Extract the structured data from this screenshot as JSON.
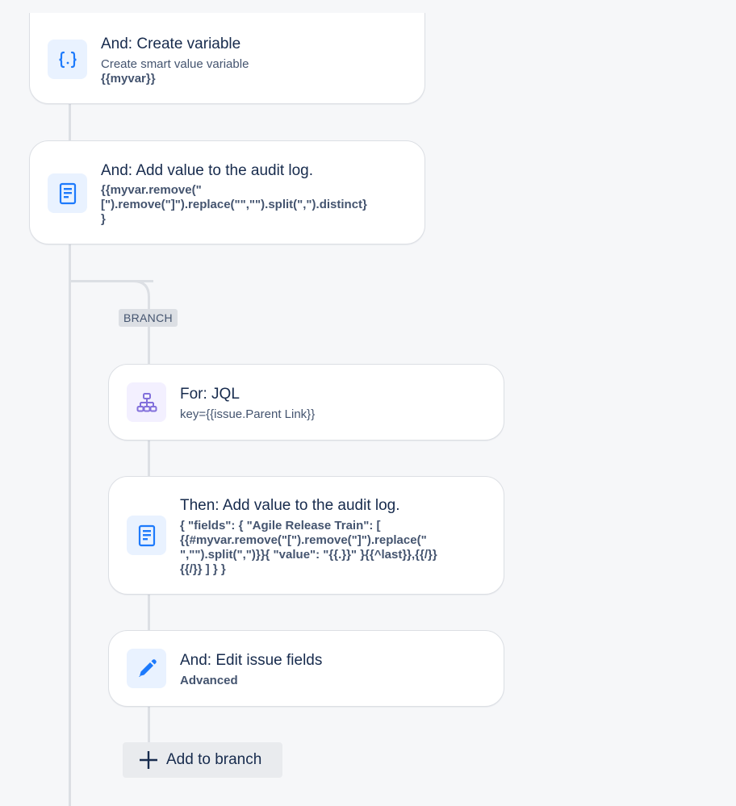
{
  "steps": [
    {
      "title": "And: Create variable",
      "subtitle": "Create smart value variable",
      "detail": "{{myvar}}",
      "icon": "curly-braces-icon"
    },
    {
      "title": "And: Add value to the audit log.",
      "code": "{{myvar.remove(\"\n[\").remove(\"]\").replace(\"\",\"\").split(\",\").distinct}\n}",
      "icon": "document-icon"
    }
  ],
  "branch": {
    "label": "BRANCH",
    "steps": [
      {
        "title": "For: JQL",
        "subtitle": "key={{issue.Parent Link}}",
        "icon": "hierarchy-icon"
      },
      {
        "title": "Then: Add value to the audit log.",
        "code": "{ \"fields\": { \"Agile Release Train\": [\n{{#myvar.remove(\"[\").remove(\"]\").replace(\"\n\",\"\").split(\",\")}}{ \"value\": \"{{.}}\" }{{^last}},{{/}}\n{{/}} ] } }",
        "icon": "document-icon"
      },
      {
        "title": "And: Edit issue fields",
        "detail": "Advanced",
        "icon": "pencil-icon"
      }
    ],
    "add_button_label": "Add to branch"
  },
  "colors": {
    "icon_blue": "#1d7afc",
    "icon_purple": "#8270db",
    "line": "#dcdfe4"
  }
}
